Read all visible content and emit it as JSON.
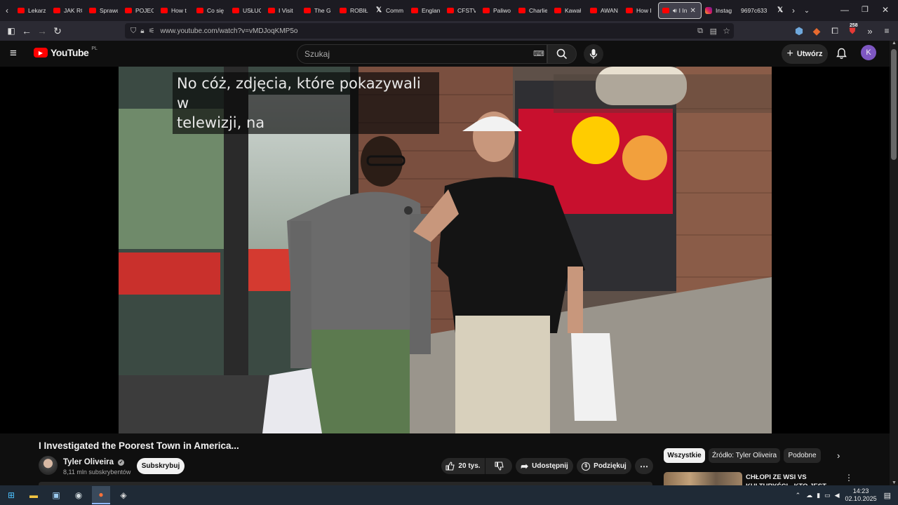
{
  "browser": {
    "tabs": [
      {
        "label": "Lekarz",
        "icon": "youtube-icon"
      },
      {
        "label": "JAK RO",
        "icon": "youtube-icon"
      },
      {
        "label": "Sprawd",
        "icon": "youtube-icon"
      },
      {
        "label": "POJECH",
        "icon": "youtube-icon"
      },
      {
        "label": "How t",
        "icon": "youtube-icon"
      },
      {
        "label": "Co się",
        "icon": "youtube-icon"
      },
      {
        "label": "USŁUG",
        "icon": "youtube-icon"
      },
      {
        "label": "I Visit",
        "icon": "youtube-icon"
      },
      {
        "label": "The G",
        "icon": "youtube-icon"
      },
      {
        "label": "ROBIŁ",
        "icon": "youtube-icon"
      },
      {
        "label": "Comm",
        "icon": "x-icon"
      },
      {
        "label": "Englan",
        "icon": "youtube-icon"
      },
      {
        "label": "CFSTV",
        "icon": "youtube-icon"
      },
      {
        "label": "Paliwo",
        "icon": "youtube-icon"
      },
      {
        "label": "Charlie",
        "icon": "youtube-icon"
      },
      {
        "label": "Kawał",
        "icon": "youtube-icon"
      },
      {
        "label": "AWAN",
        "icon": "youtube-icon"
      },
      {
        "label": "How I",
        "icon": "youtube-icon"
      },
      {
        "label": "I In",
        "icon": "youtube-icon",
        "active": true
      },
      {
        "label": "Instag",
        "icon": "instagram-icon"
      },
      {
        "label": "9697c633",
        "icon": "none"
      },
      {
        "label": "",
        "icon": "x-icon"
      }
    ],
    "url": "www.youtube.com/watch?v=vMDJoqKMP5o",
    "extension_badge": "258"
  },
  "youtube": {
    "logo": "YouTube",
    "region": "PL",
    "search_placeholder": "Szukaj",
    "create_label": "Utwórz",
    "avatar_letter": "K"
  },
  "video": {
    "caption": "No cóż, zdjęcia, które pokazywali w\ntelewizji, na",
    "title": "I Investigated the Poorest Town in America...",
    "channel": "Tyler Oliveira",
    "subscribers": "8,11 mln subskrybentów",
    "subscribe_label": "Subskrybuj",
    "likes": "20 tys.",
    "share_label": "Udostępnij",
    "thanks_label": "Podziękuj"
  },
  "recommendations": {
    "chips": [
      "Wszystkie",
      "Źródło: Tyler Oliveira",
      "Podobne"
    ],
    "first_title": "CHŁOPI ZE WSI VS KULTURYŚCI - KTO JEST"
  },
  "taskbar": {
    "time": "14:23",
    "date": "02.10.2025"
  },
  "colors": {
    "brand": "#ff0000",
    "background": "#0f0f0f",
    "avatar": "#7e57c2"
  }
}
